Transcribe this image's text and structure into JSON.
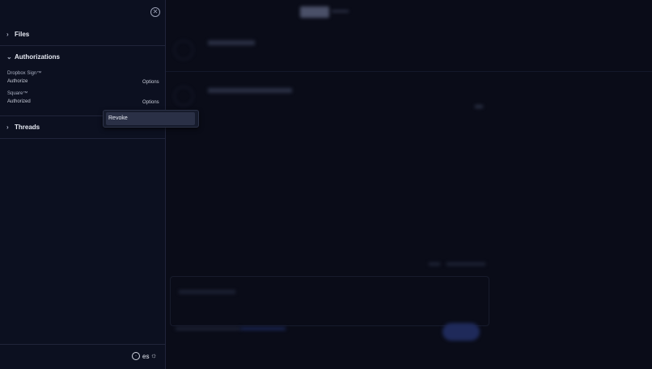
{
  "sidebar": {
    "close_icon": "circle-x-icon",
    "files": {
      "label": "Files",
      "chevron": "›"
    },
    "authorizations": {
      "label": "Authorizations",
      "chevron": "⌄",
      "items": [
        {
          "name": "Dropbox Sign™",
          "status": "Authorize",
          "options": "Options"
        },
        {
          "name": "Square™",
          "status": "Authorized",
          "options": "Options"
        }
      ]
    },
    "threads": {
      "label": "Threads",
      "chevron": "›"
    },
    "footer": {
      "language": "es",
      "globe_icon": "globe-icon",
      "theme_icon": "sun-icon"
    }
  },
  "popup": {
    "item": "Revoke"
  }
}
